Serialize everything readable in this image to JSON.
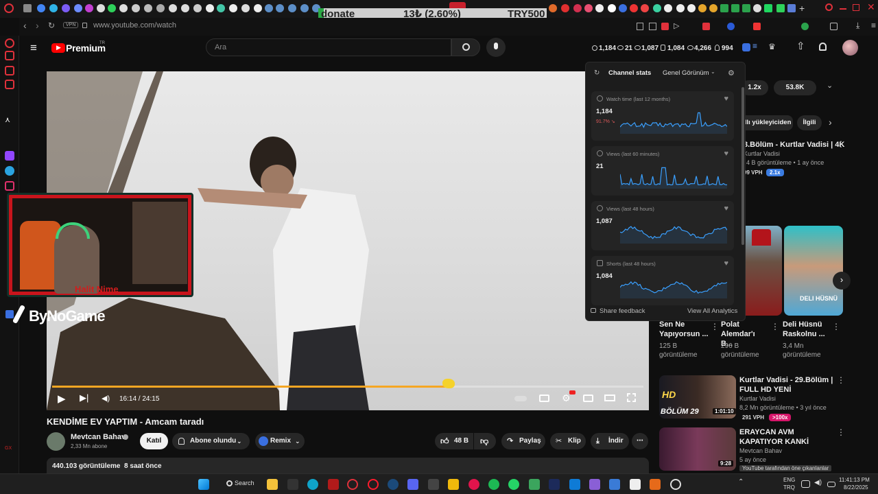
{
  "browser": {
    "url": "www.youtube.com/watch",
    "vpn_label": "VPN"
  },
  "donate": {
    "left": "donate",
    "mid": "13₺ (2.60%)",
    "right": "TRY500"
  },
  "header": {
    "logo": "Premium",
    "logo_sup": "TR",
    "search_placeholder": "Ara"
  },
  "stats": {
    "watch": "1,184",
    "live": "21",
    "views": "1,087",
    "shorts": "1,084",
    "total": "4,266",
    "subs": "994"
  },
  "analytics": {
    "tab_label": "Channel stats",
    "view_label": "Genel Görünüm",
    "cards": [
      {
        "label": "Watch time (last 12 months)",
        "value": "1,184",
        "delta": "91.7% ↘"
      },
      {
        "label": "Views (last 60 minutes)",
        "value": "21",
        "delta": ""
      },
      {
        "label": "Views (last 48 hours)",
        "value": "1,087",
        "delta": ""
      },
      {
        "label": "Shorts (last 48 hours)",
        "value": "1,084",
        "delta": ""
      }
    ],
    "feedback": "Share feedback",
    "view_all": "View All Analytics"
  },
  "overlay": {
    "cam_name": "Halit Nime",
    "brand": "ByNoGame"
  },
  "player": {
    "time": "16:14 / 24:15",
    "progress": 0.67
  },
  "video": {
    "title": "KENDİME EV YAPTIM - Amcam taradı",
    "channel": "Mevtcan Bahav",
    "subs": "2,33 Mn abone",
    "join": "Katıl",
    "subscribed": "Abone olundu",
    "remix": "Remix",
    "likes": "48 B",
    "share": "Paylaş",
    "clip": "Klip",
    "download": "İndir",
    "views_date": "440.103 görüntüleme  8 saat önce"
  },
  "sidebar_top": {
    "pill1": "1.2x",
    "pill2": "53.8K",
    "chip1": "dlı yükleyiciden",
    "chip2": "İlgili"
  },
  "rec1": {
    "title": "3.Bölüm - Kurtlar Vadisi | 4K",
    "channel": "Kurtlar Vadisi",
    "meta": "4 B görüntüleme • 1 ay önce",
    "vph": "99 VPH",
    "badge": "2.1x"
  },
  "shorts": [
    {
      "title": "Sen Ne Yapıyorsun ...",
      "views": "125 B görüntüleme"
    },
    {
      "title": "Polat Alemdar'ı B...",
      "views": "296 B görüntüleme"
    },
    {
      "title": "Deli Hüsnü Raskolnu ...",
      "views": "3,4 Mn görüntüleme",
      "thumb_text": "DELI HÜSNÜ"
    }
  ],
  "rec2": {
    "title": "Kurtlar Vadisi - 29.Bölüm | FULL HD YENİ",
    "channel": "Kurtlar Vadisi",
    "meta": "8,2 Mn görüntüleme • 3 yıl önce",
    "vph": "291 VPH",
    "badge": ">100x",
    "duration": "1:01:10",
    "thumb_text": "BÖLÜM 29",
    "hd": "HD"
  },
  "rec3": {
    "title": "ERAYCAN AVM KAPATIYOR KANKİ",
    "channel": "Mevtcan Bahav",
    "meta": "5 ay önce",
    "duration": "9:28",
    "tooltip": "YouTube tarafından öne çıkanlanlar"
  },
  "taskbar": {
    "search": "Search",
    "lang1": "ENG",
    "lang2": "TRQ",
    "time": "11:41:13 PM",
    "date": "8/22/2025"
  }
}
